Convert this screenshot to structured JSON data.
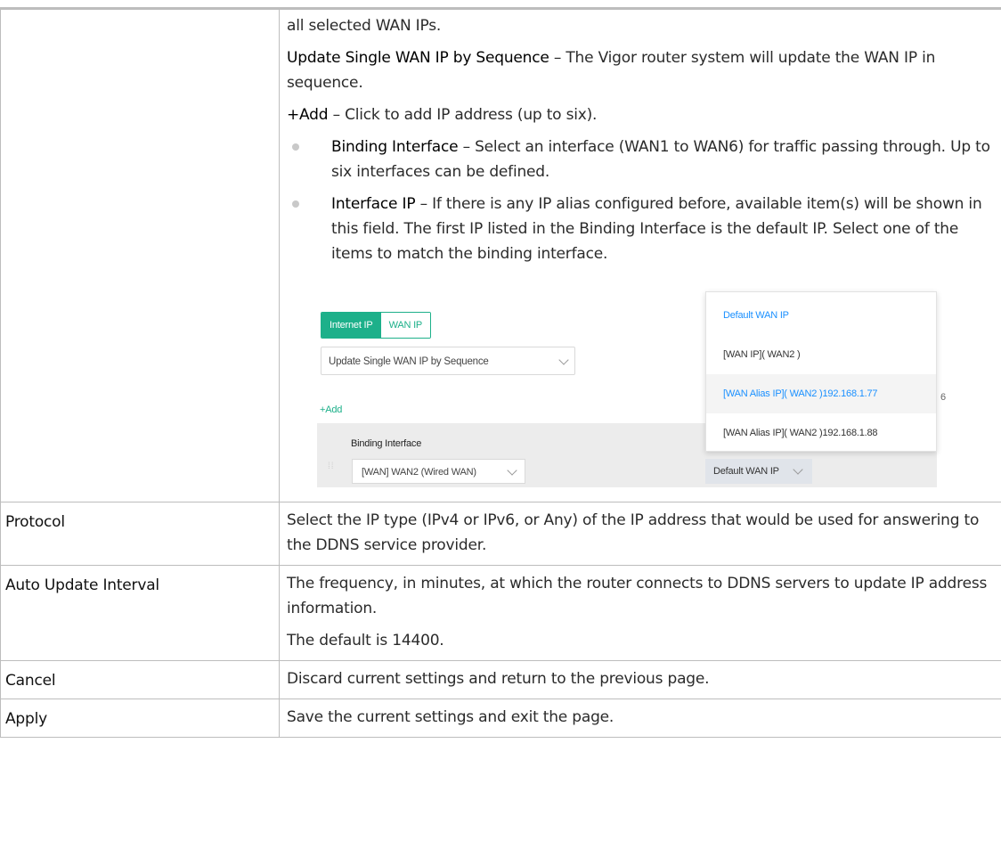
{
  "intro": {
    "line1": "all selected WAN IPs.",
    "seq_term": "Update Single WAN IP by Sequence",
    "seq_desc": " – The Vigor router system will update the WAN IP in sequence.",
    "add_term": "+Add",
    "add_desc": " – Click to add IP address (up to six).",
    "bullets": [
      {
        "term": "Binding Interface",
        "desc": " – Select an interface (WAN1 to WAN6) for traffic passing through. Up to six interfaces can be defined."
      },
      {
        "term": "Interface IP",
        "desc": " – If there is any IP alias configured before, available item(s) will be shown in this field. The first IP listed in the Binding Interface is the default IP. Select one of the items to match the binding interface."
      }
    ]
  },
  "screenshot": {
    "tab_internet_ip": "Internet IP",
    "tab_wan_ip": "WAN IP",
    "mode_select": "Update Single WAN IP by Sequence",
    "add_link": "+Add",
    "binding_interface_label": "Binding Interface",
    "binding_interface_value": "[WAN] WAN2 (Wired WAN)",
    "interface_ip_value": "Default WAN IP",
    "counter_fragment": "6",
    "dropdown_options": [
      "Default WAN IP",
      "[WAN IP]( WAN2 )",
      "[WAN Alias IP]( WAN2 )192.168.1.77",
      "[WAN Alias IP]( WAN2 )192.168.1.88"
    ],
    "accent_color": "#1db08a",
    "link_color": "#1a90ff"
  },
  "rows": [
    {
      "label": "Protocol",
      "desc": [
        "Select the IP type (IPv4 or IPv6, or Any) of the IP address that would be used for answering to the DDNS service provider."
      ]
    },
    {
      "label": "Auto Update Interval",
      "desc": [
        "The frequency, in minutes, at which the router connects to DDNS servers to update IP address information.",
        "The default is 14400."
      ]
    },
    {
      "label": "Cancel",
      "desc": [
        "Discard current settings and return to the previous page."
      ]
    },
    {
      "label": "Apply",
      "desc": [
        "Save the current settings and exit the page."
      ]
    }
  ]
}
